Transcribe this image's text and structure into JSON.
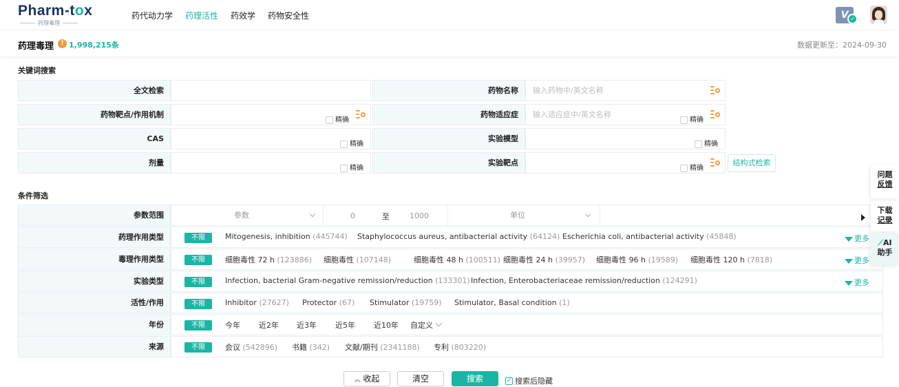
{
  "brand": {
    "name_a": "Pharm-t",
    "name_o": "o",
    "name_b": "x",
    "sub": "药理毒理"
  },
  "nav": [
    {
      "label": "药代动力学"
    },
    {
      "label": "药理活性"
    },
    {
      "label": "药效学"
    },
    {
      "label": "药物安全性"
    }
  ],
  "header": {
    "vip_label": "V",
    "title": "药理毒理",
    "info_icon": "!",
    "count": "1,998,215条",
    "update": "数据更新至：2024-09-30"
  },
  "keyword": {
    "section_title": "关键词搜索",
    "fulltext_label": "全文检索",
    "drug_name_label": "药物名称",
    "drug_name_placeholder": "输入药物中/英文名称",
    "target_label": "药物靶点/作用机制",
    "indication_label": "药物适应症",
    "indication_placeholder": "输入适应症中/英文名称",
    "cas_label": "CAS",
    "model_label": "实验模型",
    "dose_label": "剂量",
    "exp_target_label": "实验靶点",
    "exact_label": "精确",
    "struct_search": "结构式检索"
  },
  "filter": {
    "section_title": "条件筛选",
    "unlimited": "不限",
    "more": "更多",
    "param_label": "参数范围",
    "param_select": "参数",
    "range_from": "0",
    "range_sep": "至",
    "range_to": "1000",
    "unit_select": "单位",
    "rows": [
      {
        "label": "药理作用类型",
        "options": [
          {
            "text": "Mitogenesis, inhibition",
            "count": "(445744)"
          },
          {
            "text": "Staphylococcus aureus, antibacterial activity",
            "count": "(64124)"
          },
          {
            "text": "Escherichia coli, antibacterial activity",
            "count": "(45848)"
          }
        ]
      },
      {
        "label": "毒理作用类型",
        "options": [
          {
            "text": "细胞毒性 72 h",
            "count": "(123886)"
          },
          {
            "text": "细胞毒性",
            "count": "(107148)"
          },
          {
            "text": "细胞毒性 48 h",
            "count": "(100511)"
          },
          {
            "text": "细胞毒性 24 h",
            "count": "(39957)"
          },
          {
            "text": "细胞毒性 96 h",
            "count": "(19589)"
          },
          {
            "text": "细胞毒性 120 h",
            "count": "(7818)"
          }
        ]
      },
      {
        "label": "实验类型",
        "options": [
          {
            "text": "Infection, bacterial Gram-negative remission/reduction",
            "count": "(133301)"
          },
          {
            "text": "Infection, Enterobacteriaceae remission/reduction",
            "count": "(124291)"
          }
        ]
      },
      {
        "label": "活性/作用",
        "options": [
          {
            "text": "Inhibitor",
            "count": "(27627)"
          },
          {
            "text": "Protector",
            "count": "(67)"
          },
          {
            "text": "Stimulator",
            "count": "(19759)"
          },
          {
            "text": "Stimulator, Basal condition",
            "count": "(1)"
          }
        ]
      },
      {
        "label": "年份",
        "options": [
          {
            "text": "今年",
            "count": ""
          },
          {
            "text": "近2年",
            "count": ""
          },
          {
            "text": "近3年",
            "count": ""
          },
          {
            "text": "近5年",
            "count": ""
          },
          {
            "text": "近10年",
            "count": ""
          },
          {
            "text": "自定义",
            "count": ""
          }
        ]
      },
      {
        "label": "来源",
        "options": [
          {
            "text": "会议",
            "count": "(542896)"
          },
          {
            "text": "书籍",
            "count": "(342)"
          },
          {
            "text": "文献/期刊",
            "count": "(2341188)"
          },
          {
            "text": "专利",
            "count": "(803220)"
          }
        ]
      }
    ]
  },
  "side_tabs": [
    {
      "line1": "问题",
      "line2": "反馈"
    },
    {
      "line1": "下载",
      "line2": "记录"
    },
    {
      "line1": "AI",
      "line2": "助手"
    }
  ],
  "actions": {
    "collapse": "收起",
    "clear": "清空",
    "search": "搜索",
    "hide_after": "搜索后隐藏"
  },
  "colors": {
    "accent": "#1cb5a3",
    "orange": "#f39b3c",
    "navy": "#18345e"
  }
}
